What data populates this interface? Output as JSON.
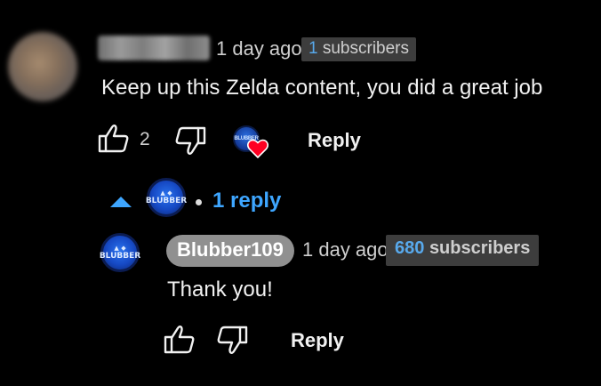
{
  "comment": {
    "author_hidden": true,
    "time": "1 day ago",
    "subscriber_count": "1",
    "subscriber_label": "subscribers",
    "text": "Keep up this Zelda content, you did a great job",
    "like_count": "2",
    "reply_label": "Reply",
    "hearted_by_creator": true
  },
  "replies_toggle": {
    "label": "1 reply",
    "expanded": true,
    "avatar_text": "BLUBBER"
  },
  "reply": {
    "author": "Blubber109",
    "avatar_text": "BLUBBER",
    "time": "1 day ago",
    "subscriber_count": "680",
    "subscriber_label": "subscribers",
    "text": "Thank you!",
    "reply_label": "Reply"
  },
  "colors": {
    "background": "#000000",
    "link_blue": "#3ea6ff",
    "heart_red": "#ff0022",
    "badge_bg": "#3d3d3d",
    "author_pill": "#909090"
  },
  "icons": {
    "like": "thumbs-up-icon",
    "dislike": "thumbs-down-icon",
    "heart": "heart-icon",
    "collapse": "triangle-up-icon"
  }
}
